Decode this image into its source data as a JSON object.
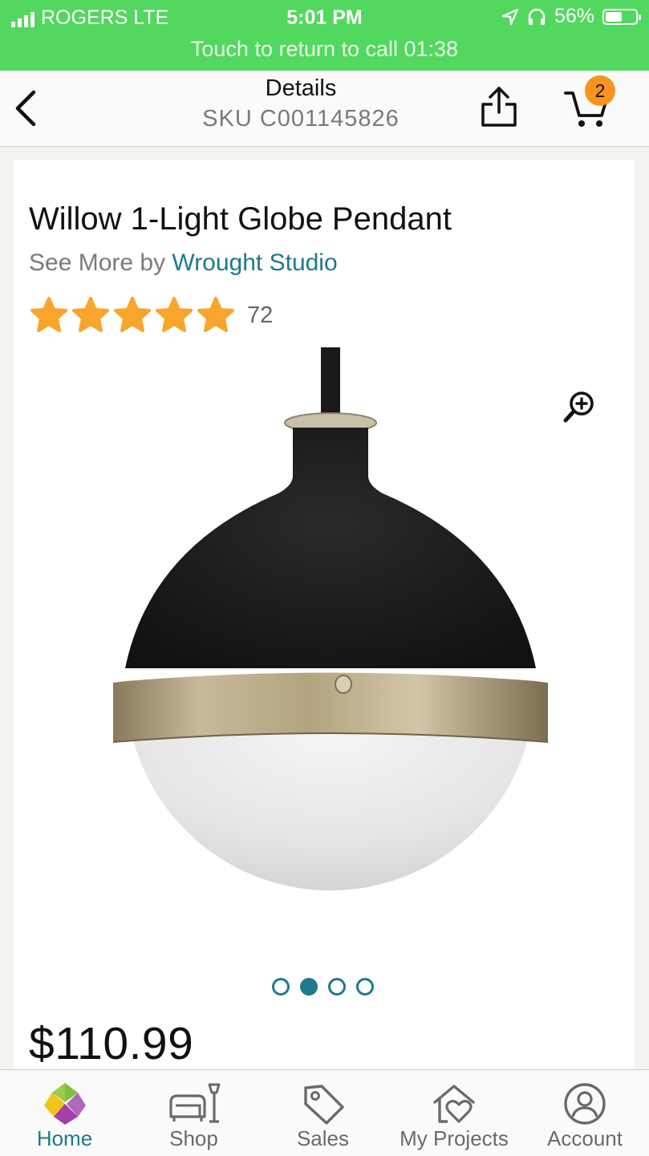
{
  "status_bar": {
    "carrier": "ROGERS  LTE",
    "time": "5:01 PM",
    "battery": "56%",
    "battery_level": 0.56,
    "call_banner": "Touch to return to call 01:38"
  },
  "header": {
    "title": "Details",
    "sku": "SKU C001145826",
    "back_icon": "chevron-left-icon",
    "share_icon": "share-icon",
    "cart_icon": "cart-icon",
    "cart_count": "2"
  },
  "product": {
    "title": "Willow 1-Light Globe Pendant",
    "see_more_prefix": "See More by ",
    "brand": "Wrought Studio",
    "rating_stars": 5,
    "review_count": "72",
    "price": "$110.99",
    "image_count": 4,
    "active_image": 2,
    "zoom_icon": "zoom-in-icon"
  },
  "tabs": [
    {
      "label": "Home",
      "icon": "home-logo-icon",
      "active": true
    },
    {
      "label": "Shop",
      "icon": "furniture-icon",
      "active": false
    },
    {
      "label": "Sales",
      "icon": "tag-icon",
      "active": false
    },
    {
      "label": "My Projects",
      "icon": "house-heart-icon",
      "active": false
    },
    {
      "label": "Account",
      "icon": "account-icon",
      "active": false
    }
  ],
  "colors": {
    "status_green": "#52d85e",
    "accent_teal": "#1e7a8c",
    "star_orange": "#f8a52c",
    "badge_orange": "#f7931e"
  }
}
